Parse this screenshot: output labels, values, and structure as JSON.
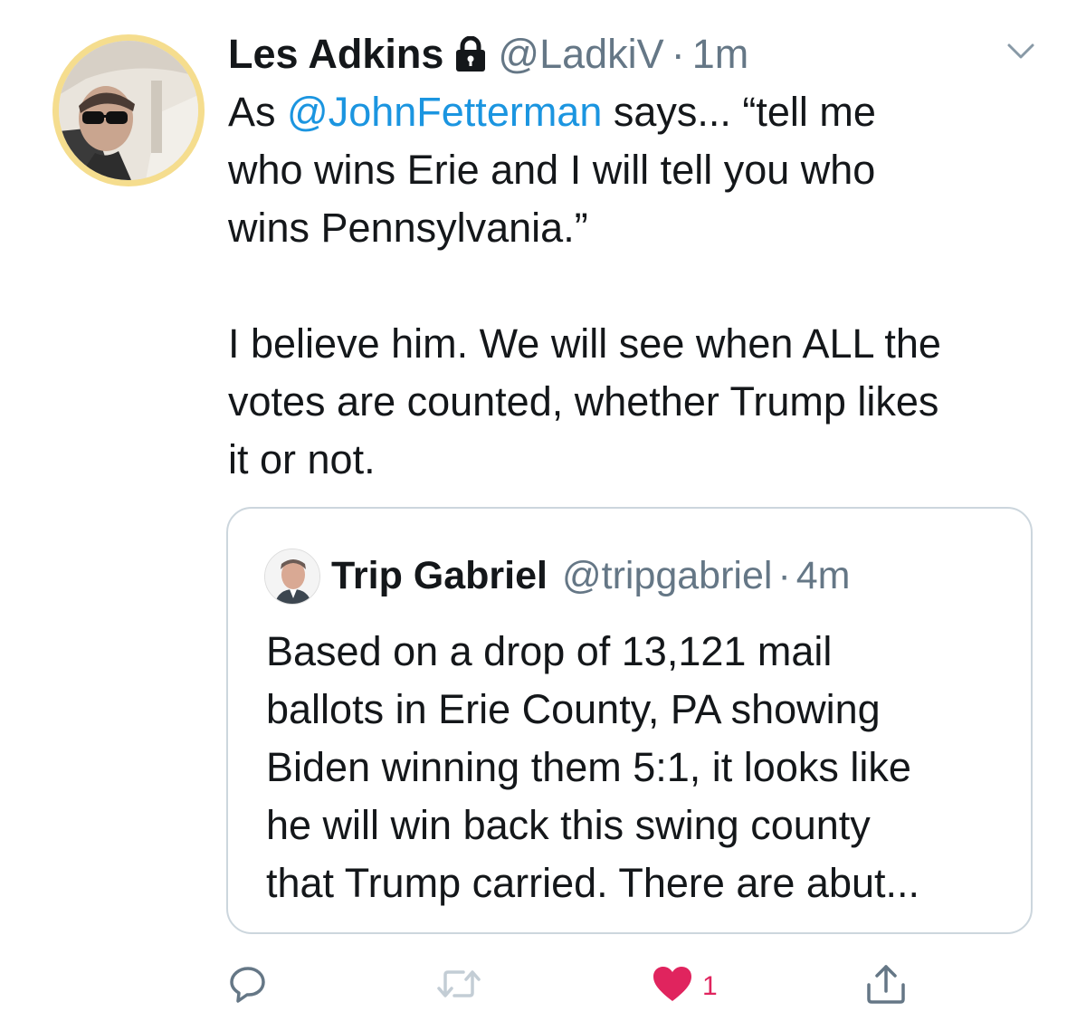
{
  "tweet": {
    "author_name": "Les Adkins",
    "handle": "@LadkiV",
    "separator": "·",
    "time": "1m",
    "text": {
      "line1_prefix": "As ",
      "line1_mention": "@JohnFetterman",
      "line1_suffix": " says... “tell me",
      "line2": "who wins Erie and I will tell you who",
      "line3": "wins Pennsylvania.”",
      "line4": "I believe him. We will see when ALL the",
      "line5": "votes are counted, whether Trump likes",
      "line6": "it or not."
    }
  },
  "quoted_tweet": {
    "author_name": "Trip Gabriel",
    "handle": "@tripgabriel",
    "separator": "·",
    "time": "4m",
    "lines": [
      "Based on a drop of 13,121 mail",
      "ballots in Erie County, PA showing",
      "Biden winning them 5:1, it looks like",
      "he will win back this swing county",
      "that Trump carried. There are abut..."
    ]
  },
  "actions": {
    "reply_icon": "reply-icon",
    "retweet_icon": "retweet-icon",
    "like_icon": "heart-icon",
    "like_count": "1",
    "share_icon": "share-icon"
  },
  "colors": {
    "link": "#1b95e0",
    "muted": "#657786",
    "like": "#e0245e",
    "avatar_ring": "#f5dd8e"
  }
}
